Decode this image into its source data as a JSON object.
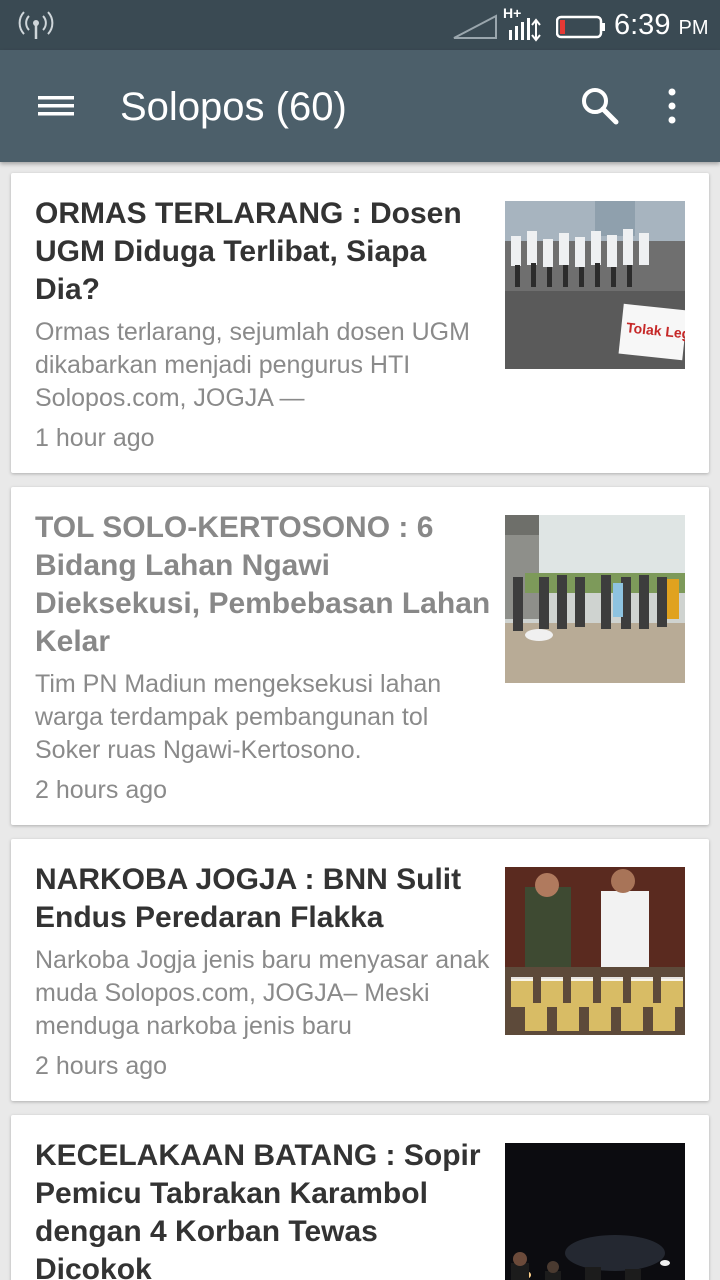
{
  "status_bar": {
    "time": "6:39",
    "ampm": "PM",
    "network_label": "H+"
  },
  "app_bar": {
    "title": "Solopos (60)"
  },
  "articles": [
    {
      "headline": "ORMAS TERLARANG : Dosen UGM Diduga Terlibat, Siapa Dia?",
      "snippet": "Ormas terlarang, sejumlah dosen UGM dikabarkan menjadi pengurus HTI Solopos.com, JOGJA —",
      "time": "1 hour ago",
      "thumb_text": "Tolak Legal",
      "read": false
    },
    {
      "headline": "TOL SOLO-KERTOSONO : 6 Bidang Lahan Ngawi Dieksekusi, Pembebasan Lahan Kelar",
      "snippet": "Tim PN Madiun mengeksekusi lahan warga terdampak pembangunan tol Soker ruas Ngawi-Kertosono.",
      "time": "2 hours ago",
      "read": true
    },
    {
      "headline": "NARKOBA JOGJA : BNN Sulit Endus Peredaran Flakka",
      "snippet": "Narkoba Jogja jenis baru menyasar anak muda Solopos.com, JOGJA– Meski menduga narkoba jenis baru",
      "time": "2 hours ago",
      "read": false
    },
    {
      "headline": "KECELAKAAN BATANG : Sopir Pemicu Tabrakan Karambol dengan 4 Korban Tewas Dicokok",
      "snippet": "",
      "time": "",
      "read": false
    }
  ],
  "colors": {
    "status_bar": "#3a4a53",
    "app_bar": "#4c5f6a",
    "background": "#e9e9e9",
    "headline": "#333333",
    "headline_read": "#888888",
    "meta_text": "#8a8a8a",
    "battery_low": "#e53935"
  },
  "icons": [
    "hotspot-icon",
    "signal-empty-icon",
    "signal-hplus-icon",
    "battery-icon",
    "menu-icon",
    "search-icon",
    "more-vert-icon"
  ]
}
